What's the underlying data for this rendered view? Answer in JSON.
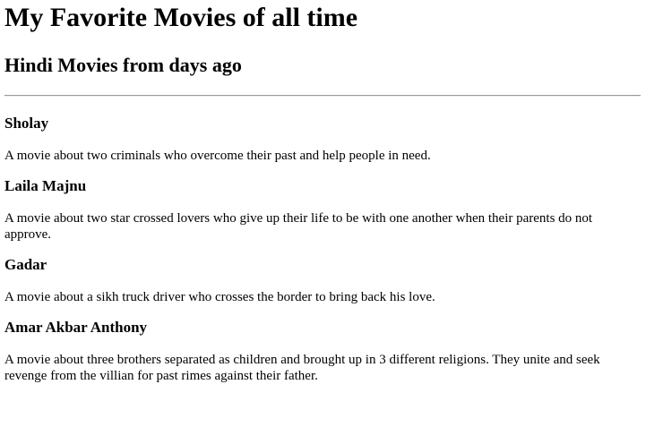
{
  "page": {
    "title": "My Favorite Movies of all time",
    "subtitle": "Hindi Movies from days ago"
  },
  "movies": [
    {
      "title": "Sholay",
      "description": "A movie about two criminals who overcome their past and help people in need."
    },
    {
      "title": "Laila Majnu",
      "description": "A movie about two star crossed lovers who give up their life to be with one another when their parents do not approve."
    },
    {
      "title": "Gadar",
      "description": "A movie about a sikh truck driver who crosses the border to bring back his love."
    },
    {
      "title": "Amar Akbar Anthony",
      "description": "A movie about three brothers separated as children and brought up in 3 different religions. They unite and seek revenge from the villian for past rimes against their father."
    }
  ]
}
